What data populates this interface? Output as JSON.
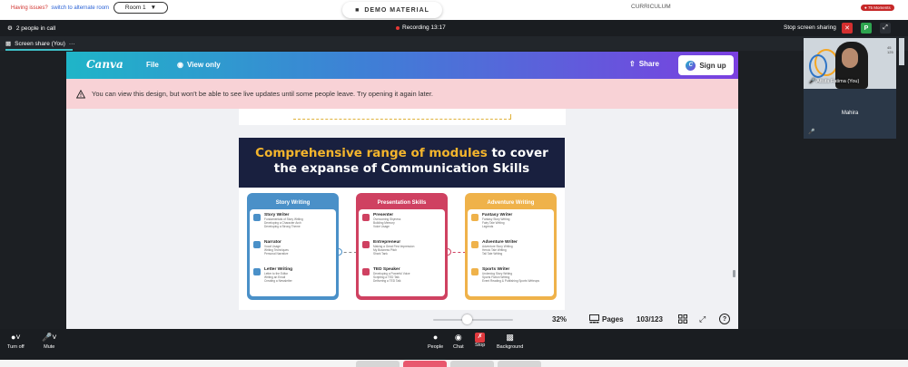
{
  "host_bar": {
    "issues_text": "Having issues?",
    "issues_link": "switch to alternate room",
    "room_value": "Room 1",
    "demo_label": "DEMO MATERIAL",
    "curriculum_label": "CURRICULUM",
    "moments_label": "75 Moments"
  },
  "meeting_header": {
    "people_count": "2 people in call",
    "recording": "Recording 13:17",
    "stop_sharing": "Stop screen sharing",
    "p_label": "P"
  },
  "share_bar": {
    "tab_label": "Screen share (You)",
    "more": "···"
  },
  "canva": {
    "logo": "Canva",
    "file": "File",
    "view_only": "View only",
    "share": "Share",
    "signup": "Sign up",
    "warning": "You can view this design, but won't be able to see live updates until some people leave. Try opening it again later.",
    "slide": {
      "title_highlight": "Comprehensive range of modules",
      "title_rest_1": " to cover",
      "title_line_2": "the expanse of Communication Skills",
      "cards": [
        {
          "heading": "Story Writing",
          "items": [
            {
              "title": "Story Writer",
              "lines": [
                "Fundamentals of Story Writing",
                "Developing a Character Arch",
                "Developing a Strong Theme"
              ]
            },
            {
              "title": "Narrator",
              "lines": [
                "Vocal Usage",
                "Writing Techniques",
                "Personal Narrative"
              ]
            },
            {
              "title": "Letter Writing",
              "lines": [
                "Letter to the Editor",
                "Writing an Email",
                "Creating a Newsletter"
              ]
            }
          ]
        },
        {
          "heading": "Presentation Skills",
          "items": [
            {
              "title": "Presenter",
              "lines": [
                "Overcoming Shyness",
                "Building Memory",
                "Voice Usage"
              ]
            },
            {
              "title": "Entrepreneur",
              "lines": [
                "Making a Great First Impression",
                "My Business Pitch",
                "Shark Tank"
              ]
            },
            {
              "title": "TED Speaker",
              "lines": [
                "Developing a Powerful Voice",
                "Scripting a TED Talk",
                "Delivering a TED Talk"
              ]
            }
          ]
        },
        {
          "heading": "Adventure Writing",
          "items": [
            {
              "title": "Fantasy Writer",
              "lines": [
                "Fantasy Story Writing",
                "Fairy Tale Writing",
                "Legends"
              ]
            },
            {
              "title": "Adventure Writer",
              "lines": [
                "Adventure Story Writing",
                "Heroic Tale Writing",
                "Tall Tale Writing"
              ]
            },
            {
              "title": "Sports Writer",
              "lines": [
                "Underdog Story Writing",
                "Sports Fiction Writing",
                "Event Reading & Publishing Sports Writeups"
              ]
            }
          ]
        }
      ]
    },
    "zoom": {
      "percent": "32%",
      "level": 0.32
    },
    "pages_label": "Pages",
    "page_count": "103/123"
  },
  "participants": [
    {
      "name": "Attufa Fatima (You)",
      "side_text": [
        "45",
        "125"
      ]
    },
    {
      "name": "Mahira"
    }
  ],
  "toolbar": {
    "turn_off": "Turn off",
    "mute": "Mute",
    "people": "People",
    "chat": "Chat",
    "stop": "Stop",
    "background": "Background"
  },
  "colors": {
    "canva_gradient_start": "#1fb5c8",
    "canva_gradient_end": "#7b3fe0",
    "warning_bg": "#f8d2d6",
    "recording_dot": "#e53935",
    "slide_header_bg": "#19203f",
    "title_highlight": "#f4b52c"
  }
}
